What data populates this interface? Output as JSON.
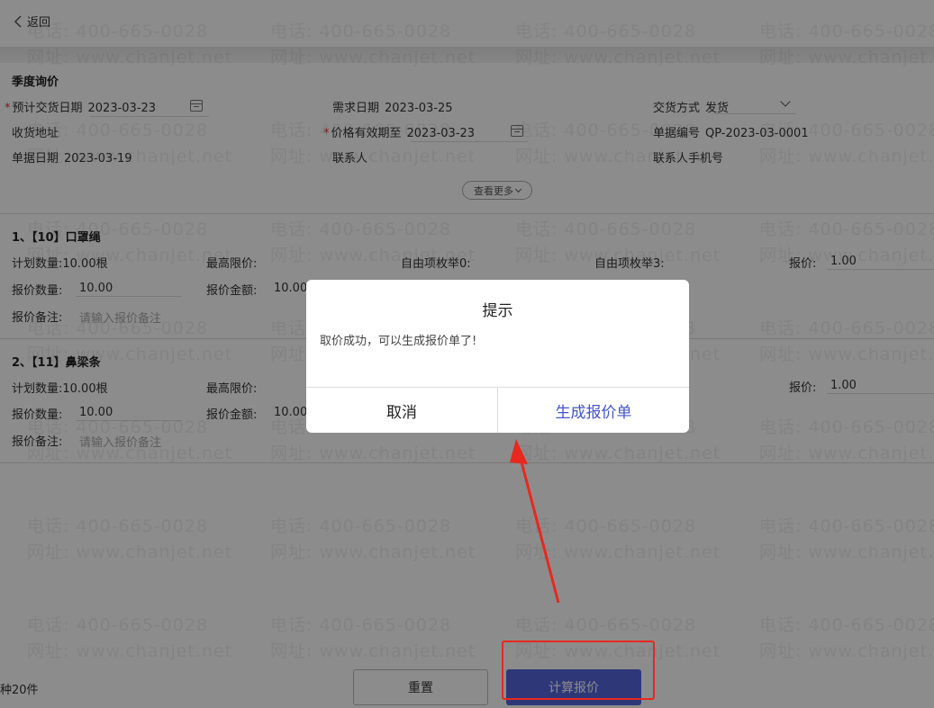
{
  "header": {
    "back_label": "返回"
  },
  "season_inquiry": {
    "title": "季度询价",
    "expected_delivery_date": {
      "label": "预计交货日期",
      "value": "2023-03-23"
    },
    "demand_date": {
      "label": "需求日期",
      "value": "2023-03-25"
    },
    "delivery_method": {
      "label": "交货方式",
      "value": "发货"
    },
    "receiving_address": {
      "label": "收货地址"
    },
    "price_valid_until": {
      "label": "价格有效期至",
      "value": "2023-03-23"
    },
    "document_number": {
      "label": "单据编号",
      "value": "QP-2023-03-0001"
    },
    "document_date": {
      "label": "单据日期",
      "value": "2023-03-19"
    },
    "contact": {
      "label": "联系人"
    },
    "contact_phone": {
      "label": "联系人手机号"
    },
    "view_more": "查看更多"
  },
  "items": [
    {
      "title": "1、【10】口罩绳",
      "planned_qty": "计划数量:10.00根",
      "max_price_label": "最高限价:",
      "free_enum_0": "自由项枚举0:",
      "free_enum_3": "自由项枚举3:",
      "quote_price_label": "报价:",
      "quote_price_value": "1.00",
      "quote_qty_label": "报价数量:",
      "quote_qty_value": "10.00",
      "quote_amount_label": "报价金额:",
      "quote_amount_value": "10.00",
      "note_label": "报价备注:",
      "note_placeholder": "请输入报价备注"
    },
    {
      "title": "2、【11】鼻梁条",
      "planned_qty": "计划数量:10.00根",
      "max_price_label": "最高限价:",
      "quote_price_label": "报价:",
      "quote_price_value": "1.00",
      "quote_qty_label": "报价数量:",
      "quote_qty_value": "10.00",
      "quote_amount_label": "报价金额:",
      "quote_amount_value": "10.00",
      "note_label": "报价备注:",
      "note_placeholder": "请输入报价备注"
    }
  ],
  "footer": {
    "count_text": "种20件",
    "reset_label": "重置",
    "calculate_label": "计算报价"
  },
  "dialog": {
    "title": "提示",
    "message": "取价成功，可以生成报价单了!",
    "cancel_label": "取消",
    "confirm_label": "生成报价单"
  },
  "watermark": {
    "phone": "电话: 400-665-0028",
    "website": "网址: www.chanjet.net"
  },
  "colors": {
    "primary": "#5566dd",
    "confirm_text": "#4455cc",
    "required": "#e53935",
    "annotation": "#e8281e"
  }
}
